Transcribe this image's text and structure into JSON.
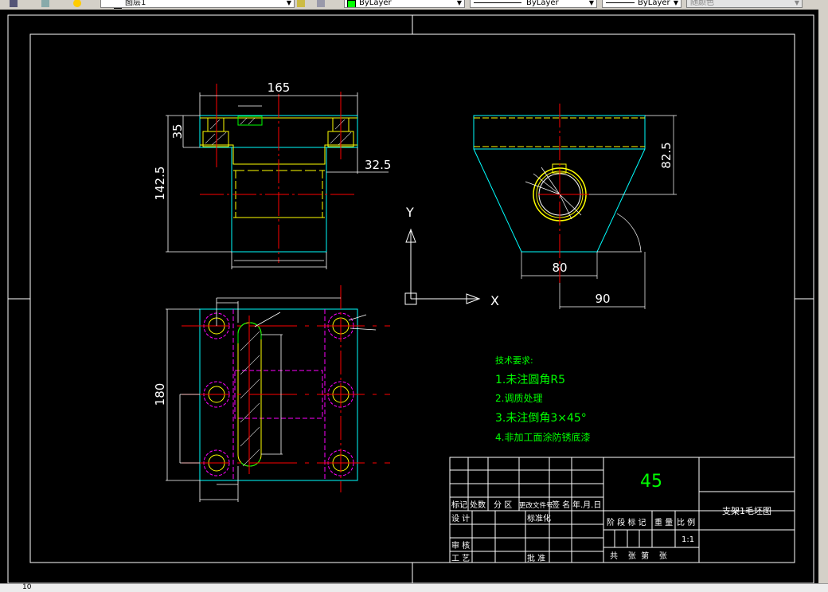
{
  "toolbar": {
    "layer_name": "图层1",
    "color_value": "ByLayer",
    "linetype_value": "ByLayer",
    "lineweight_value": "ByLayer",
    "plotstyle_value": "随颜色"
  },
  "status": {
    "coords": "10"
  },
  "drawing": {
    "top_view_dims": {
      "width": "165",
      "height": "142.5",
      "flange": "35",
      "step": "32.5"
    },
    "side_view_dims": {
      "height": "82.5",
      "bottom": "80",
      "offset": "90"
    },
    "plan_view_dims": {
      "height": "180"
    },
    "ucs": {
      "x_label": "X",
      "y_label": "Y"
    }
  },
  "tech_requirements": {
    "title": "技术要求:",
    "items": [
      "1.未注圆角R5",
      "2.调质处理",
      "3.未注倒角3×45°",
      "4.非加工面涂防锈底漆"
    ]
  },
  "title_block": {
    "material": "45",
    "drawing_name": "支架1毛坯图",
    "scale": "1:1",
    "headers": {
      "mark": "标记",
      "count": "处数",
      "zone": "分 区",
      "change_doc": "更改文件号",
      "signature": "签 名",
      "date": "年.月.日",
      "design": "设 计",
      "standardize": "标准化",
      "review": "审 核",
      "process": "工 艺",
      "approve": "批 准",
      "stage_mark": "阶 段 标 记",
      "weight": "重 量",
      "ratio": "比 例",
      "sheets": "共    张  第    张"
    }
  },
  "colors": {
    "background": "#000000",
    "line": "#ffffff",
    "center": "#ff0000",
    "hidden": "#ff00ff",
    "cyan": "#00ffff",
    "yellow": "#ffff00",
    "green": "#00ff00"
  }
}
